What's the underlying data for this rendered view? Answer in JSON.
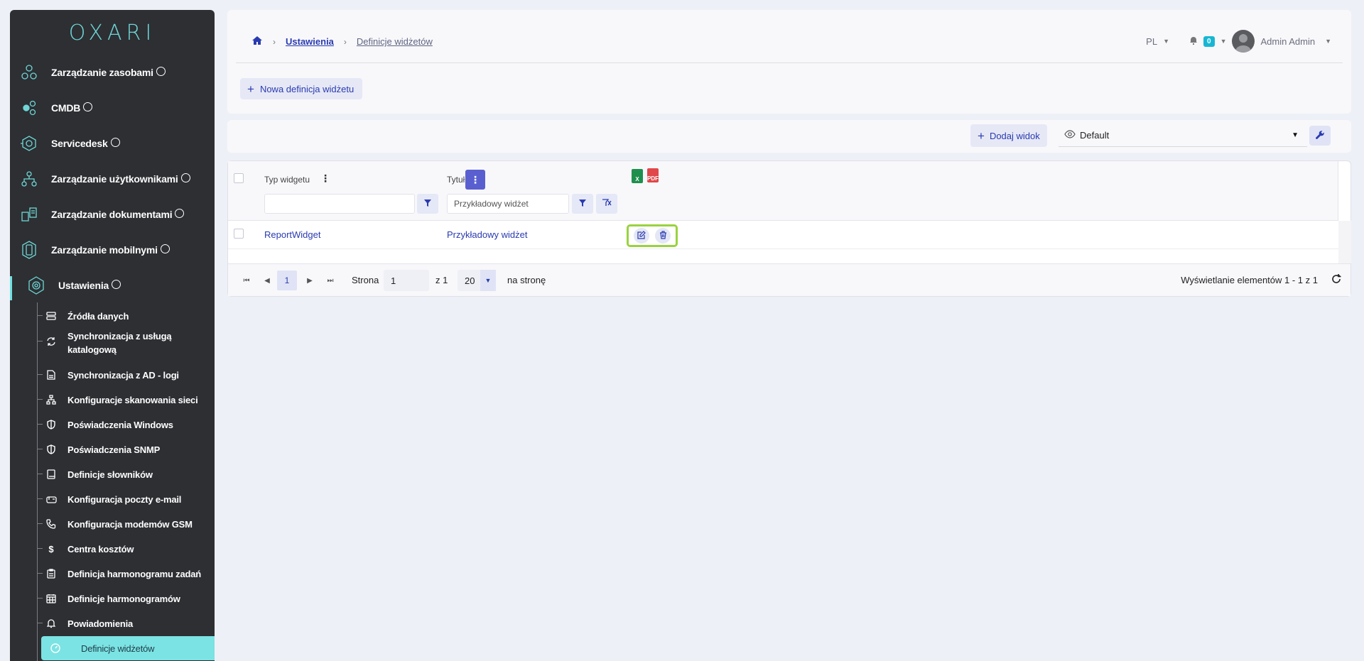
{
  "app": {
    "logo": "OXARI"
  },
  "sidebar": {
    "items": [
      {
        "label": "Zarządzanie zasobami",
        "icon": "hexagon-cluster-icon"
      },
      {
        "label": "CMDB",
        "icon": "cmdb-network-icon"
      },
      {
        "label": "Servicedesk",
        "icon": "servicedesk-icon"
      },
      {
        "label": "Zarządzanie użytkownikami",
        "icon": "users-tree-icon"
      },
      {
        "label": "Zarządzanie dokumentami",
        "icon": "documents-icon"
      },
      {
        "label": "Zarządzanie mobilnymi",
        "icon": "mobile-device-icon"
      },
      {
        "label": "Ustawienia",
        "icon": "settings-gear-icon"
      }
    ],
    "subitems": [
      {
        "label": "Źródła danych",
        "icon": "database-icon"
      },
      {
        "label": "Synchronizacja z usługą katalogową",
        "icon": "sync-icon"
      },
      {
        "label": "Synchronizacja z AD - logi",
        "icon": "file-log-icon"
      },
      {
        "label": "Konfiguracje skanowania sieci",
        "icon": "network-scan-icon"
      },
      {
        "label": "Poświadczenia Windows",
        "icon": "shield-icon"
      },
      {
        "label": "Poświadczenia SNMP",
        "icon": "shield-icon"
      },
      {
        "label": "Definicje słowników",
        "icon": "book-icon"
      },
      {
        "label": "Konfiguracja poczty e-mail",
        "icon": "mailbox-icon"
      },
      {
        "label": "Konfiguracja modemów GSM",
        "icon": "phone-icon"
      },
      {
        "label": "Centra kosztów",
        "icon": "dollar-icon"
      },
      {
        "label": "Definicja harmonogramu zadań",
        "icon": "clipboard-icon"
      },
      {
        "label": "Definicje harmonogramów",
        "icon": "calendar-icon"
      },
      {
        "label": "Powiadomienia",
        "icon": "bell-icon"
      },
      {
        "label": "Definicje widżetów",
        "icon": "widget-gauge-icon"
      }
    ]
  },
  "header": {
    "breadcrumb": [
      "Ustawienia",
      "Definicje widżetów"
    ],
    "language": "PL",
    "notifications": "0",
    "user": "Admin Admin",
    "new_button": "Nowa definicja widżetu"
  },
  "toolbar": {
    "add_view": "Dodaj widok",
    "view_selected": "Default"
  },
  "grid": {
    "columns": [
      "Typ widgetu",
      "Tytuł"
    ],
    "filters": {
      "type": "",
      "title": "Przykładowy widżet"
    },
    "export": {
      "excel": "X",
      "pdf": "PDF"
    },
    "rows": [
      {
        "type": "ReportWidget",
        "title": "Przykładowy widżet"
      }
    ]
  },
  "pager": {
    "current_page": "1",
    "page_label": "Strona",
    "page_input": "1",
    "of_label": "z 1",
    "page_size": "20",
    "per_page_label": "na stronę",
    "summary": "Wyświetlanie elementów 1 - 1 z 1"
  },
  "colors": {
    "accent": "#2a3bb0",
    "sidebar_bg": "#2d2f33",
    "teal": "#7be3e3",
    "highlight": "#9ad23f"
  }
}
